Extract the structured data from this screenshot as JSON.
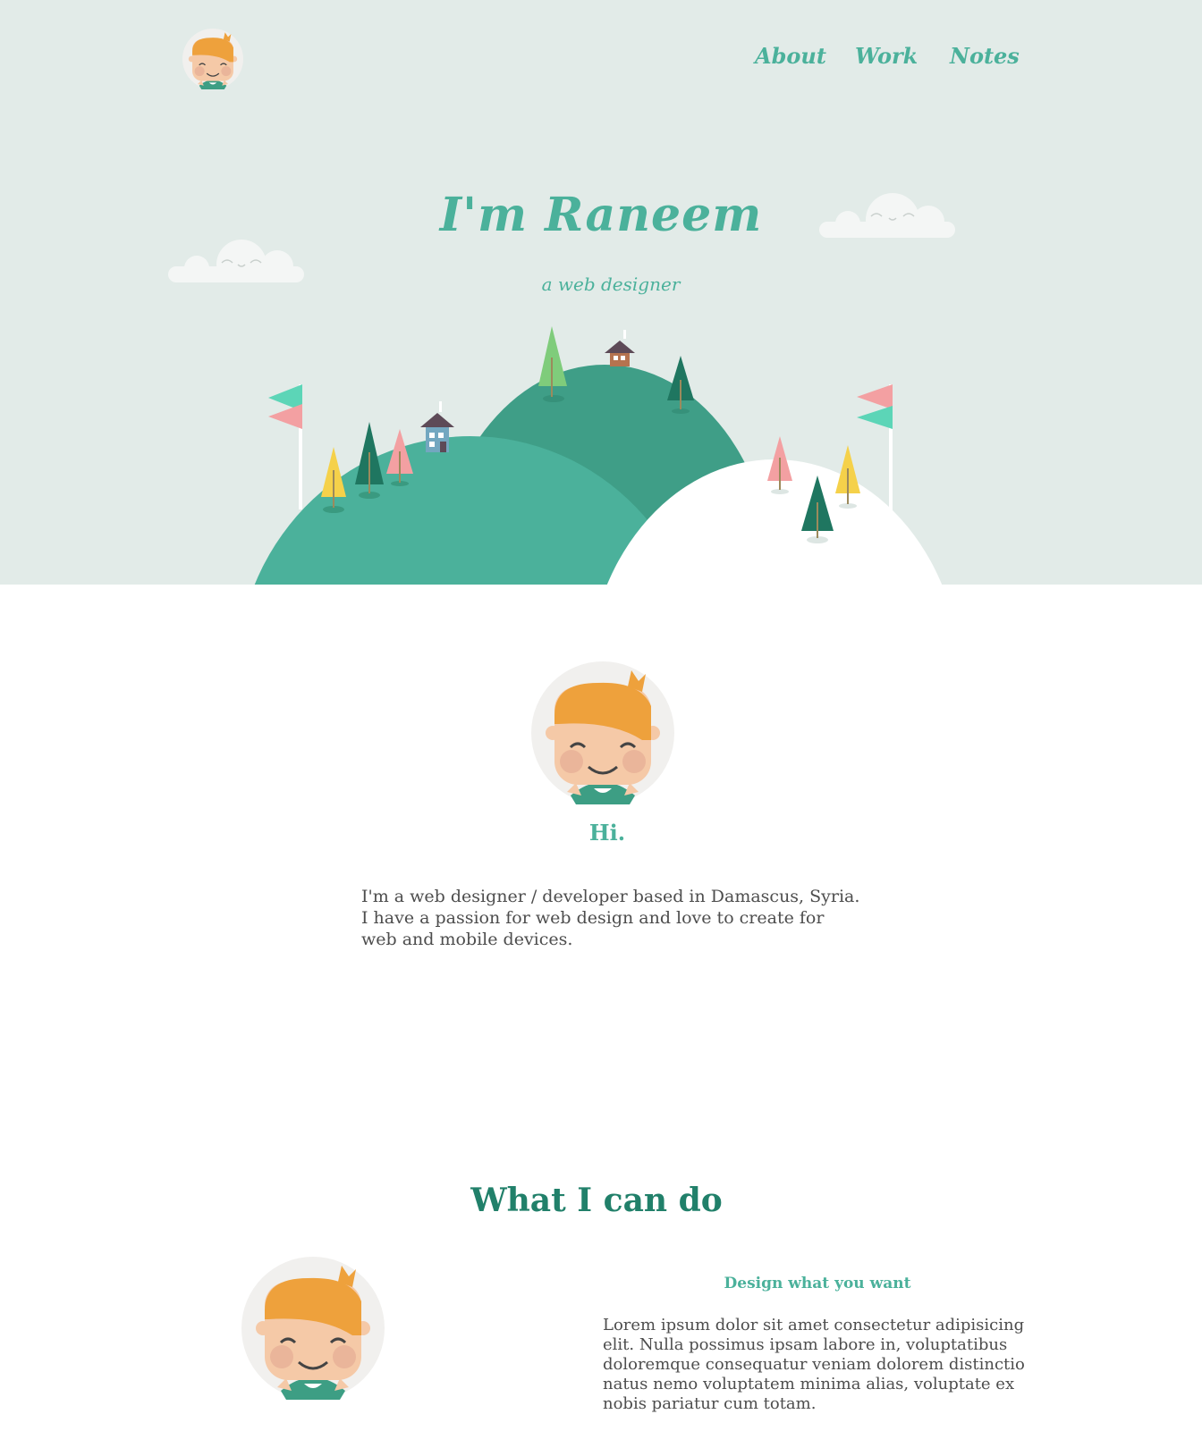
{
  "nav": {
    "items": [
      {
        "label": "About"
      },
      {
        "label": "Work"
      },
      {
        "label": "Notes"
      }
    ]
  },
  "hero": {
    "title": "I'm Raneem",
    "subtitle": "a web designer"
  },
  "about": {
    "heading": "Hi.",
    "text": "I'm a web designer / developer based in Damascus, Syria. I have a passion for web design and love to create for web and mobile devices."
  },
  "skills": {
    "title": "What I can do",
    "items": [
      {
        "heading": "Design what you want",
        "text": "Lorem ipsum dolor sit amet consectetur adipisicing elit. Nulla possimus ipsam labore in, voluptatibus doloremque consequatur veniam dolorem distinctio natus nemo voluptatem minima alias, voluptate ex nobis pariatur cum totam."
      }
    ]
  },
  "colors": {
    "accent": "#4bb19b",
    "dark_accent": "#21806a",
    "hero_bg": "#e2ebe8",
    "hair": "#eea13c",
    "skin": "#f5c9a7",
    "shirt": "#3d9e84"
  },
  "icons": [
    "avatar-illustration",
    "cloud-illustration",
    "hills-scene-illustration"
  ]
}
